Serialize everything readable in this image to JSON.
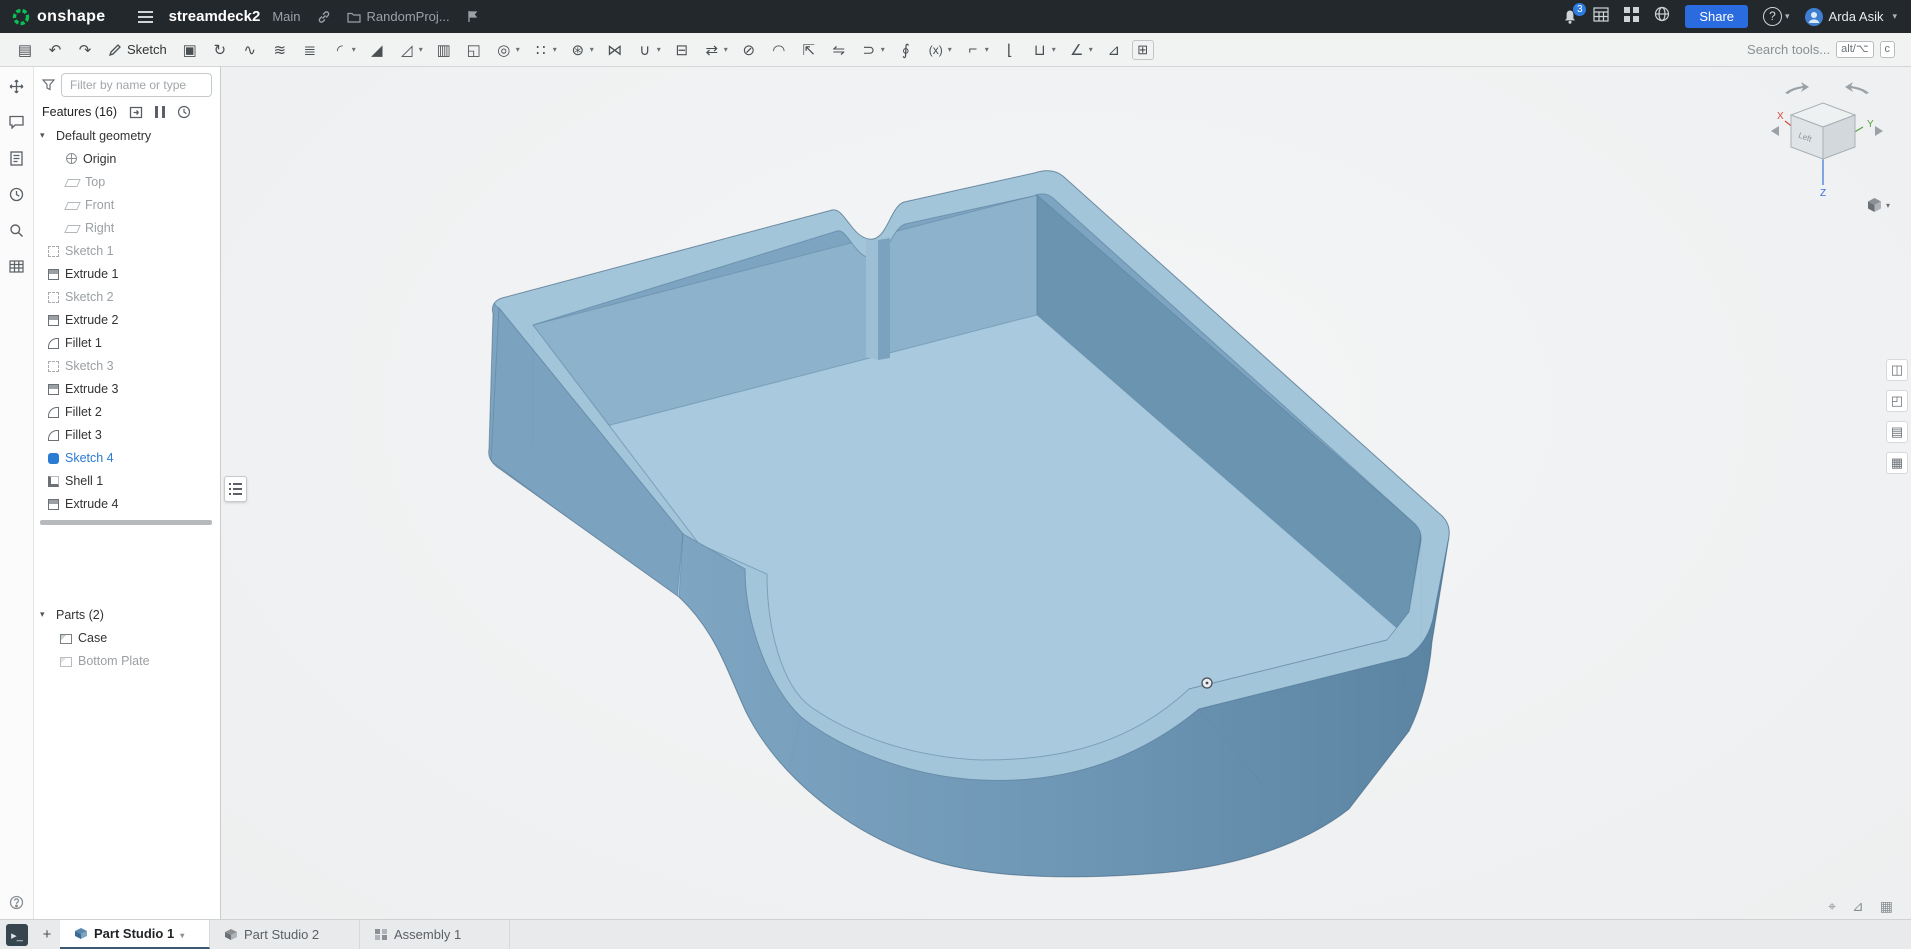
{
  "header": {
    "logo": "onshape",
    "document_title": "streamdeck2",
    "workspace_label": "Main",
    "project_label": "RandomProj...",
    "notification_badge": "3",
    "share_button": "Share",
    "help_glyph": "?",
    "user_name": "Arda Asik"
  },
  "toolbar": {
    "sketch_button": "Sketch",
    "search_label": "Search tools...",
    "shortcut_alt": "alt/⌥",
    "shortcut_key": "c",
    "tools": [
      {
        "name": "feature-list-toggle",
        "glyph": "▤"
      },
      {
        "name": "undo",
        "glyph": "↶"
      },
      {
        "name": "redo",
        "glyph": "↷"
      },
      {
        "name": "extrude",
        "glyph": "▣"
      },
      {
        "name": "revolve",
        "glyph": "↻"
      },
      {
        "name": "sweep",
        "glyph": "∿"
      },
      {
        "name": "loft",
        "glyph": "≋"
      },
      {
        "name": "thicken",
        "glyph": "≣"
      },
      {
        "name": "fillet",
        "glyph": "◜"
      },
      {
        "name": "chamfer",
        "glyph": "◢"
      },
      {
        "name": "draft",
        "glyph": "◿"
      },
      {
        "name": "rib",
        "glyph": "▥"
      },
      {
        "name": "shell",
        "glyph": "◱"
      },
      {
        "name": "hole",
        "glyph": "◎"
      },
      {
        "name": "linear-pattern",
        "glyph": "∷"
      },
      {
        "name": "circular-pattern",
        "glyph": "⊛"
      },
      {
        "name": "mirror",
        "glyph": "⋈"
      },
      {
        "name": "boolean",
        "glyph": "∪"
      },
      {
        "name": "split",
        "glyph": "⊟"
      },
      {
        "name": "transform",
        "glyph": "⇄"
      },
      {
        "name": "delete-part",
        "glyph": "⊘"
      },
      {
        "name": "modify-fillet",
        "glyph": "◠"
      },
      {
        "name": "move-face",
        "glyph": "⇱"
      },
      {
        "name": "replace-face",
        "glyph": "⇋"
      },
      {
        "name": "offset-surface",
        "glyph": "⊃"
      },
      {
        "name": "helix",
        "glyph": "∮"
      },
      {
        "name": "variable",
        "glyph": "(x)"
      },
      {
        "name": "sheet-metal",
        "glyph": "⌐"
      },
      {
        "name": "flange",
        "glyph": "⌊"
      },
      {
        "name": "tab-feature",
        "glyph": "⊔"
      },
      {
        "name": "measure",
        "glyph": "∠"
      },
      {
        "name": "mass-properties",
        "glyph": "⊿"
      },
      {
        "name": "custom-feature",
        "glyph": "⊞"
      }
    ]
  },
  "left_rail": {
    "items": [
      "move",
      "comments",
      "notes",
      "history",
      "search",
      "tables",
      "help"
    ]
  },
  "feature_panel": {
    "filter_placeholder": "Filter by name or type",
    "features_title": "Features (16)",
    "tree": [
      {
        "label": "Default geometry"
      },
      {
        "label": "Origin"
      },
      {
        "label": "Top"
      },
      {
        "label": "Front"
      },
      {
        "label": "Right"
      },
      {
        "label": "Sketch 1"
      },
      {
        "label": "Extrude 1"
      },
      {
        "label": "Sketch 2"
      },
      {
        "label": "Extrude 2"
      },
      {
        "label": "Fillet 1"
      },
      {
        "label": "Sketch 3"
      },
      {
        "label": "Extrude 3"
      },
      {
        "label": "Fillet 2"
      },
      {
        "label": "Fillet 3"
      },
      {
        "label": "Sketch 4"
      },
      {
        "label": "Shell 1"
      },
      {
        "label": "Extrude 4"
      }
    ],
    "parts_title": "Parts (2)",
    "parts": [
      {
        "label": "Case"
      },
      {
        "label": "Bottom Plate"
      }
    ]
  },
  "viewport": {
    "view_cube": {
      "x": "X",
      "y": "Y",
      "z": "Z",
      "face_label": "Left"
    },
    "status_icons": [
      "crosshair",
      "measure",
      "grid"
    ],
    "right_stack_icons": [
      "configurations",
      "appearance",
      "display-states",
      "tables"
    ]
  },
  "tab_bar": {
    "tabs": [
      {
        "label": "Part Studio 1"
      },
      {
        "label": "Part Studio 2"
      },
      {
        "label": "Assembly 1"
      }
    ]
  },
  "colors": {
    "header_bg": "#23282d",
    "accent_blue": "#2a6ce0",
    "selection_blue": "#2a7bd2",
    "logo_green": "#0abf53",
    "model_rim": "#a3c5da",
    "model_floor": "#a9cade",
    "model_wall": "#6e97b5"
  }
}
